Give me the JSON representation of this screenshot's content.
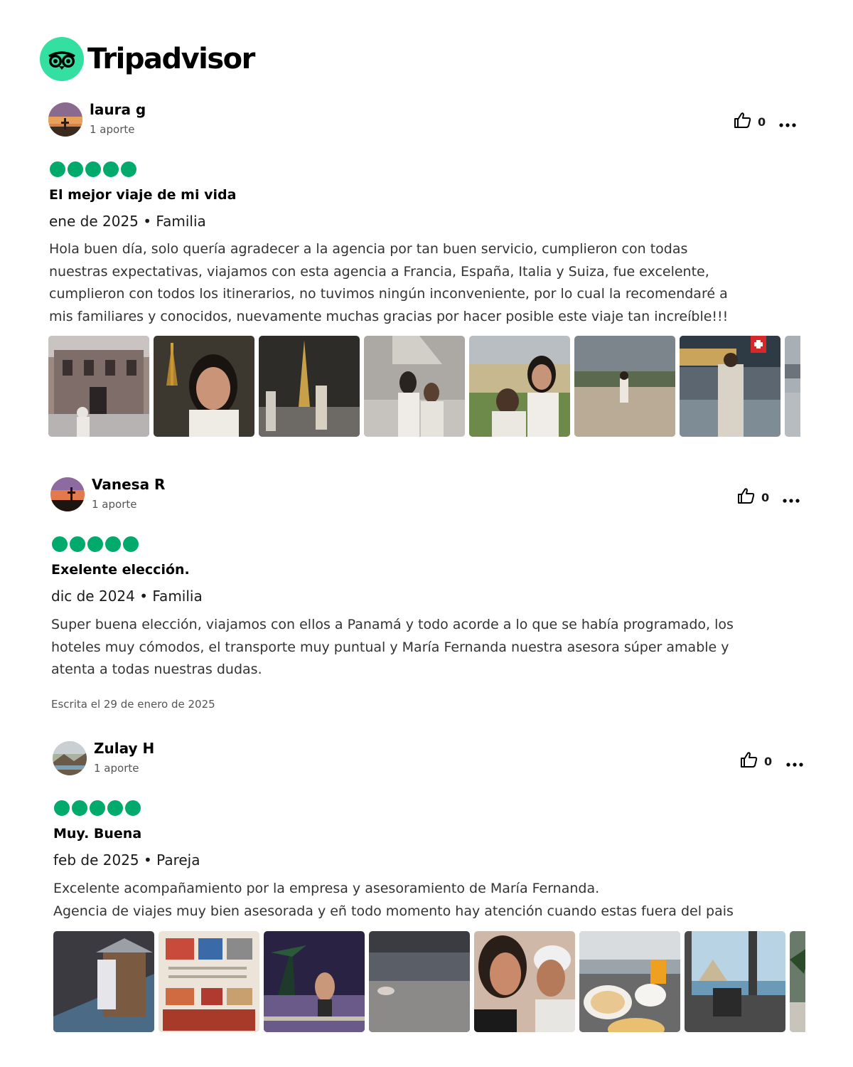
{
  "brand": {
    "name": "Tripadvisor",
    "mark_icon": "owl-eyes-icon",
    "accent": "#34e0a1",
    "rating_color": "#00aa6c"
  },
  "reviews": [
    {
      "author": "laura g",
      "contributions": "1 aporte",
      "rating": 5,
      "helpful_votes": "0",
      "title": "El mejor viaje de mi vida",
      "trip_date": "ene de 2025",
      "trip_type": "Familia",
      "meta_separator": "•",
      "text_lines": [
        "Hola buen día, solo quería agradecer a la agencia por tan buen servicio, cumplieron con todas",
        "nuestras expectativas, viajamos con esta agencia a Francia, España, Italia y Suiza, fue excelente,",
        "cumplieron con todos los itinerarios, no tuvimos ningún inconveniente, por lo cual la recomendaré a",
        "mis familiares y conocidos, nuevamente muchas gracias por hacer posible este viaje tan increíble!!!"
      ],
      "written_date": "",
      "photos": [
        {
          "theme": "chateau"
        },
        {
          "theme": "selfie-night"
        },
        {
          "theme": "eiffel-night"
        },
        {
          "theme": "louvre-pair"
        },
        {
          "theme": "palace-pair"
        },
        {
          "theme": "garden-view"
        },
        {
          "theme": "lake-flag"
        },
        {
          "theme": "partial"
        }
      ]
    },
    {
      "author": "Vanesa R",
      "contributions": "1 aporte",
      "rating": 5,
      "helpful_votes": "0",
      "title": "Exelente elección.",
      "trip_date": "dic de 2024",
      "trip_type": "Familia",
      "meta_separator": "•",
      "text_lines": [
        "Super buena elección, viajamos con ellos a Panamá y todo acorde a lo que se había programado, los",
        "hoteles muy cómodos, el transporte muy puntual y María Fernanda nuestra asesora súper amable y",
        "atenta a todas nuestras dudas."
      ],
      "written_date": "Escrita el 29 de enero de 2025",
      "photos": []
    },
    {
      "author": "Zulay H",
      "contributions": "1 aporte",
      "rating": 5,
      "helpful_votes": "0",
      "title": "Muy. Buena",
      "trip_date": "feb de 2025",
      "trip_type": "Pareja",
      "meta_separator": "•",
      "text_lines": [
        "Excelente acompañamiento por la empresa y asesoramiento de María Fernanda.",
        "Agencia de viajes muy bien asesorada y eñ todo momento hay atención cuando estas fuera del pais"
      ],
      "written_date": "",
      "photos": [
        {
          "theme": "cabana-night"
        },
        {
          "theme": "menu-flyer"
        },
        {
          "theme": "palm-night"
        },
        {
          "theme": "beach-night"
        },
        {
          "theme": "selfie-pair"
        },
        {
          "theme": "breakfast"
        },
        {
          "theme": "terrace"
        },
        {
          "theme": "partial-palm"
        }
      ]
    }
  ]
}
